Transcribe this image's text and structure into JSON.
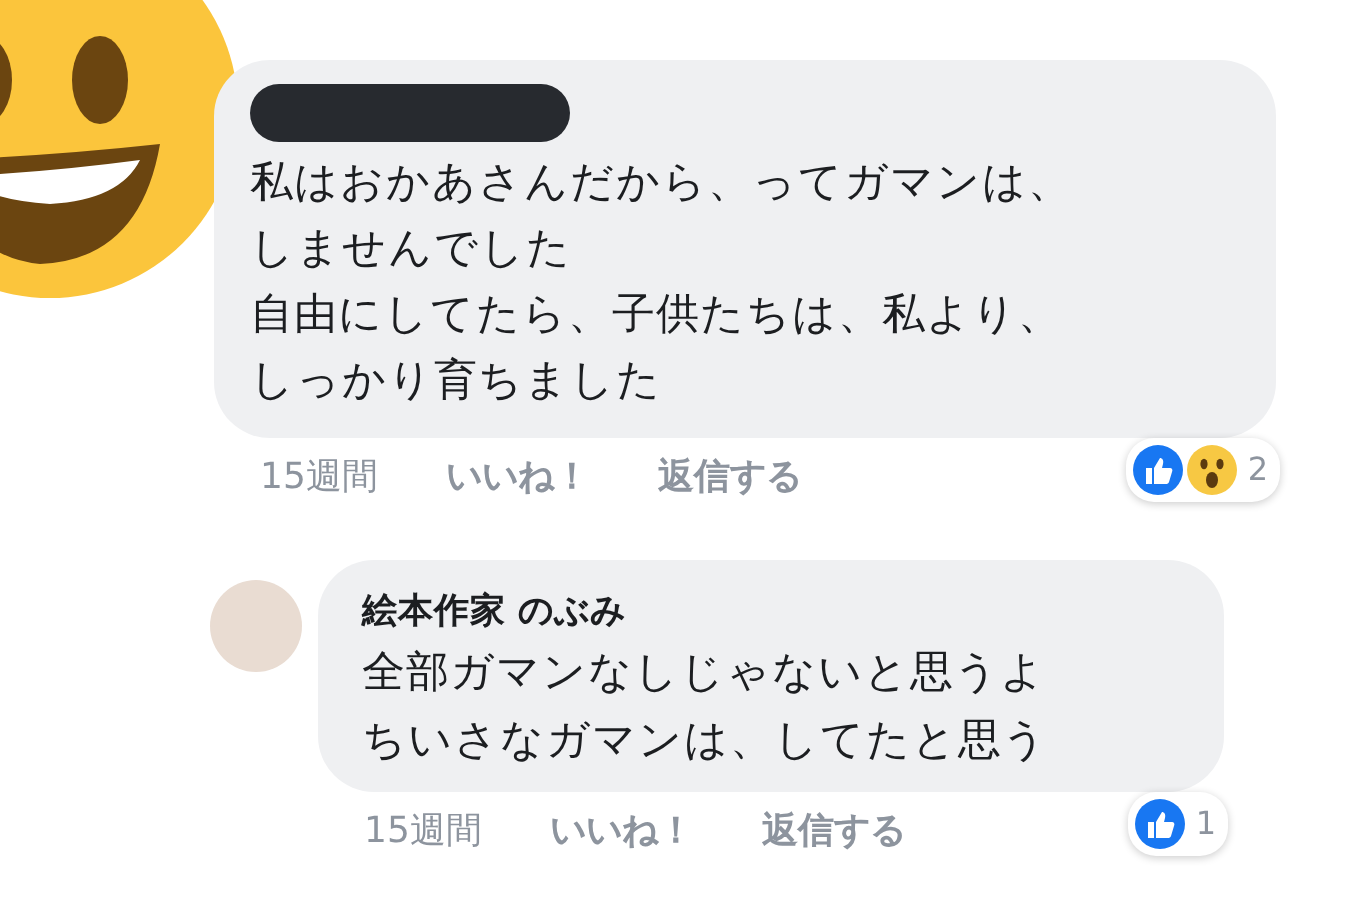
{
  "comments": [
    {
      "author": {
        "redacted": true
      },
      "avatar": {
        "kind": "sticker"
      },
      "lines": [
        "私はおかあさんだから、ってガマンは、",
        "しませんでした",
        "自由にしてたら、子供たちは、私より、",
        "しっかり育ちました"
      ],
      "time": "15週間",
      "like_label": "いいね！",
      "reply_label": "返信する",
      "reactions": {
        "kinds": [
          {
            "kind": "like"
          },
          {
            "kind": "wow"
          }
        ],
        "count": "2"
      }
    },
    {
      "author": {
        "name": "絵本作家 のぶみ"
      },
      "avatar": {
        "kind": "photo"
      },
      "lines": [
        "全部ガマンなしじゃないと思うよ",
        "ちいさなガマンは、してたと思う"
      ],
      "time": "15週間",
      "like_label": "いいね！",
      "reply_label": "返信する",
      "reactions": {
        "kinds": [
          {
            "kind": "like"
          }
        ],
        "count": "1"
      }
    }
  ]
}
